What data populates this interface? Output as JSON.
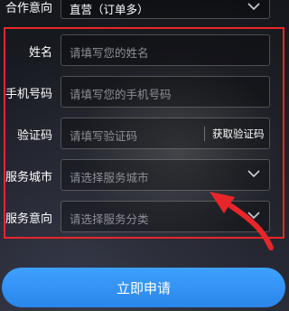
{
  "form": {
    "cooperation": {
      "label": "合作意向",
      "value": "直营（订单多）"
    },
    "name": {
      "label": "姓名",
      "placeholder": "请填写您的姓名"
    },
    "phone": {
      "label": "手机号码",
      "placeholder": "请填写您的手机号码"
    },
    "code": {
      "label": "验证码",
      "placeholder": "请填写验证码",
      "button": "获取验证码"
    },
    "city": {
      "label": "服务城市",
      "placeholder": "请选择服务城市"
    },
    "service": {
      "label": "服务意向",
      "placeholder": "请选择服务分类"
    }
  },
  "submit_label": "立即申请",
  "colors": {
    "annotation_red": "#e8262a",
    "submit_blue": "#2a86ea",
    "placeholder_gray": "#8e8f96"
  },
  "icons": {
    "select": "chevron-down-icon",
    "annotation": "red-arrow-icon"
  }
}
